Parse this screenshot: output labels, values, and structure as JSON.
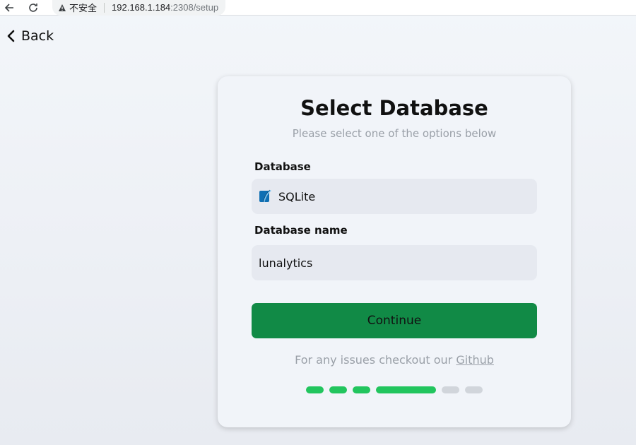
{
  "browser": {
    "security_label": "不安全",
    "url_host": "192.168.1.184",
    "url_rest": ":2308/setup"
  },
  "back": {
    "label": "Back"
  },
  "card": {
    "title": "Select Database",
    "subtitle": "Please select one of the options below",
    "database_label": "Database",
    "database_value": "SQLite",
    "database_icon": "sqlite-icon",
    "dbname_label": "Database name",
    "dbname_value": "lunalytics",
    "continue_label": "Continue",
    "footer_prefix": "For any issues checkout our ",
    "footer_link": "Github"
  },
  "progress": {
    "steps": [
      {
        "state": "done",
        "color": "#22c55e"
      },
      {
        "state": "done",
        "color": "#22c55e"
      },
      {
        "state": "done",
        "color": "#22c55e"
      },
      {
        "state": "current",
        "color": "#22c55e"
      },
      {
        "state": "pending",
        "color": "#d1d5db"
      },
      {
        "state": "pending",
        "color": "#d1d5db"
      }
    ]
  },
  "colors": {
    "accent": "#118a46",
    "step_active": "#22c55e",
    "step_inactive": "#d1d5db"
  }
}
